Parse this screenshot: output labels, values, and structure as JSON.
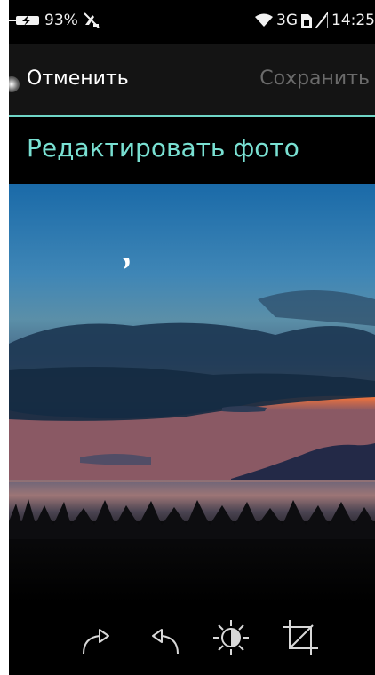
{
  "status_bar": {
    "battery": "93%",
    "network": "3G",
    "time": "14:25",
    "icons": [
      "battery-charging-icon",
      "no-notifications-icon",
      "wifi-icon",
      "sim-icon",
      "signal-icon"
    ]
  },
  "action_bar": {
    "cancel_label": "Отменить",
    "save_label": "Сохранить",
    "accent_color": "#6fd6c7"
  },
  "header": {
    "title": "Редактировать фото"
  },
  "photo": {
    "subject": "sunset-over-lake-with-moon"
  },
  "toolbar": {
    "tools": [
      "rotate-right-icon",
      "rotate-left-icon",
      "brightness-contrast-icon",
      "crop-icon"
    ]
  }
}
